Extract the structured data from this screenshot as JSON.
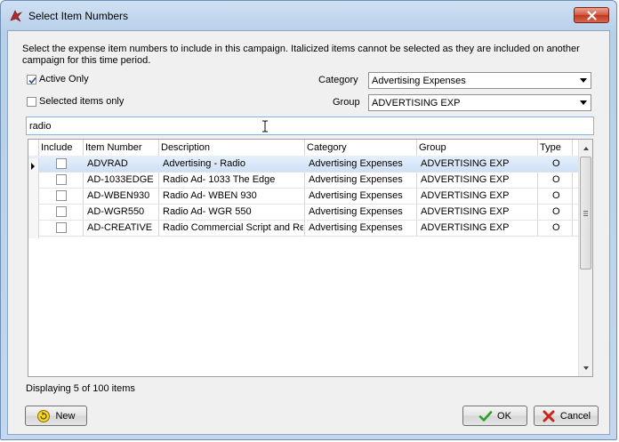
{
  "window": {
    "title": "Select Item Numbers"
  },
  "instructions": "Select the expense item numbers to include in this campaign. Italicized items cannot be selected as they are included on another campaign for this time period.",
  "filters": {
    "active_only_label": "Active Only",
    "active_only_checked": true,
    "selected_only_label": "Selected items only",
    "selected_only_checked": false,
    "category_label": "Category",
    "category_value": "Advertising Expenses",
    "group_label": "Group",
    "group_value": "ADVERTISING EXP"
  },
  "search": {
    "value": "radio"
  },
  "grid": {
    "columns": [
      "Include",
      "Item Number",
      "Description",
      "Category",
      "Group",
      "Type"
    ],
    "rows": [
      {
        "item": "ADVRAD",
        "description": "Advertising - Radio",
        "category": "Advertising Expenses",
        "group": "ADVERTISING EXP",
        "type": "O"
      },
      {
        "item": "AD-1033EDGE",
        "description": "Radio Ad- 1033 The Edge",
        "category": "Advertising Expenses",
        "group": "ADVERTISING EXP",
        "type": "O"
      },
      {
        "item": "AD-WBEN930",
        "description": "Radio Ad- WBEN 930",
        "category": "Advertising Expenses",
        "group": "ADVERTISING EXP",
        "type": "O"
      },
      {
        "item": "AD-WGR550",
        "description": "Radio Ad- WGR 550",
        "category": "Advertising Expenses",
        "group": "ADVERTISING EXP",
        "type": "O"
      },
      {
        "item": "AD-CREATIVE",
        "description": "Radio Commercial Script and Recording",
        "category": "Advertising Expenses",
        "group": "ADVERTISING EXP",
        "type": "O"
      }
    ]
  },
  "status": "Displaying 5 of 100 items",
  "buttons": {
    "new": "New",
    "ok": "OK",
    "cancel": "Cancel"
  },
  "icons": {
    "app": "app-logo-icon",
    "close": "close-icon",
    "new": "new-icon",
    "ok": "checkmark-icon",
    "cancel": "cancel-x-icon"
  },
  "colors": {
    "ok_check": "#2aa02a",
    "cancel_x": "#c8251b",
    "selection": "#cfe1f6"
  }
}
